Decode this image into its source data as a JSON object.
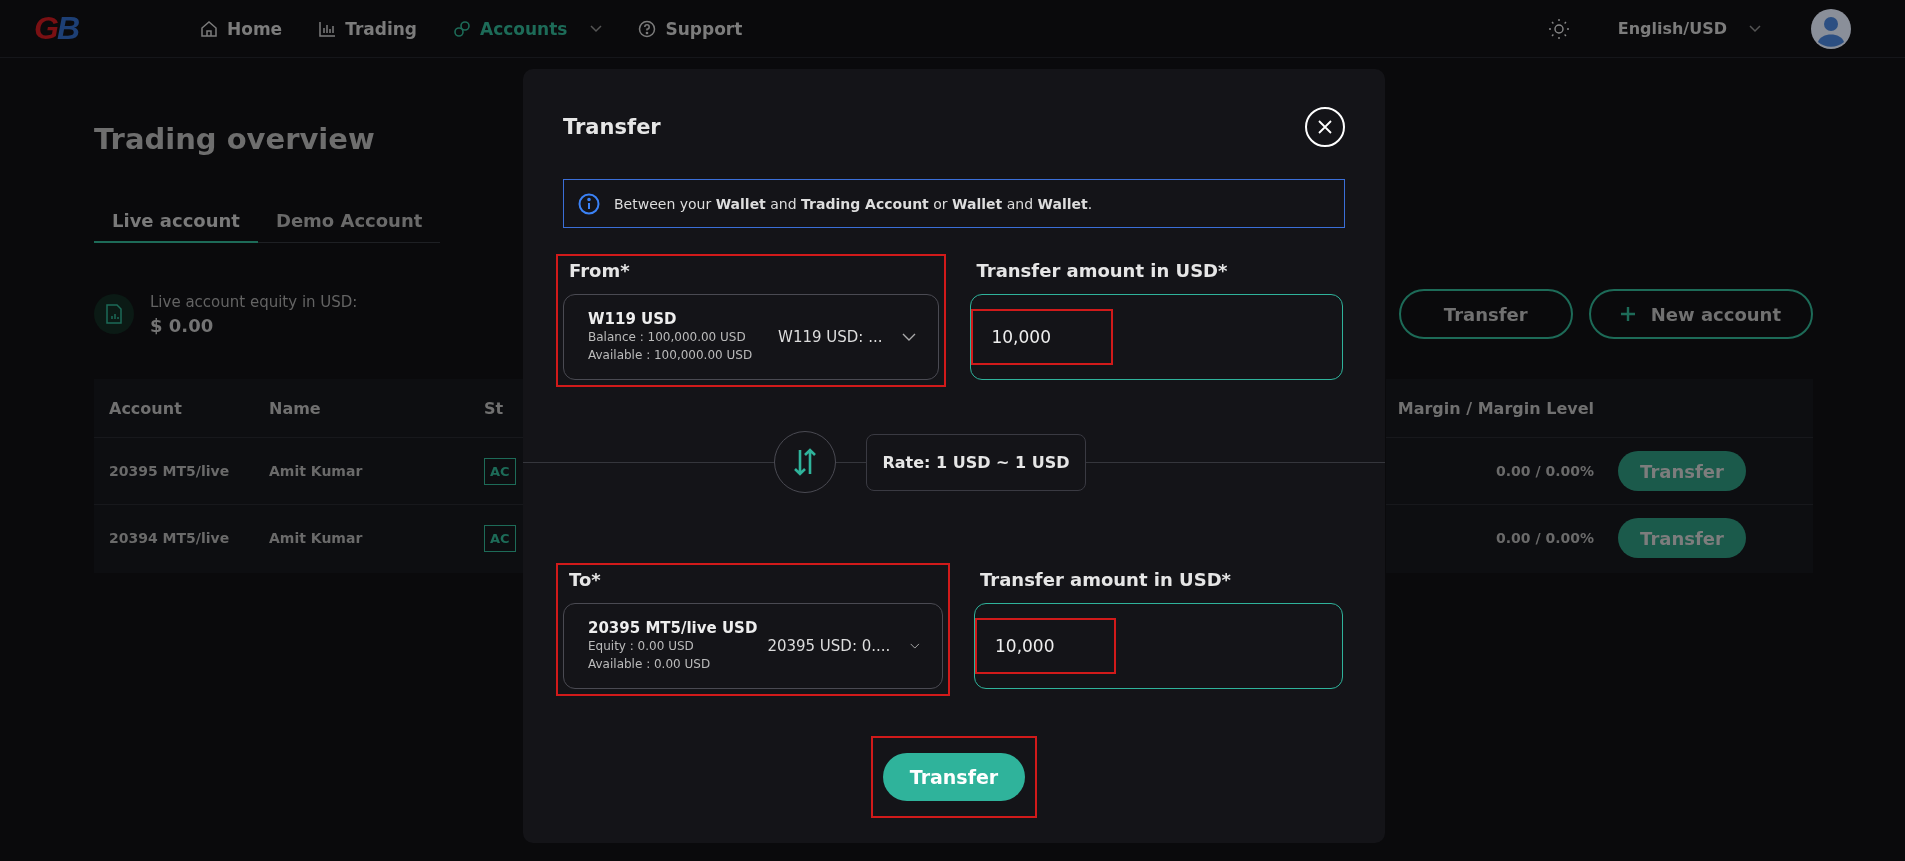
{
  "logo": {
    "first": "G",
    "second": "B"
  },
  "nav": [
    {
      "label": "Home",
      "selected": false,
      "dropdown": false
    },
    {
      "label": "Trading",
      "selected": false,
      "dropdown": false
    },
    {
      "label": "Accounts",
      "selected": true,
      "dropdown": true
    },
    {
      "label": "Support",
      "selected": false,
      "dropdown": false
    }
  ],
  "language": "English/USD",
  "page": {
    "title": "Trading overview",
    "tabs": [
      {
        "label": "Live account",
        "selected": true
      },
      {
        "label": "Demo Account",
        "selected": false
      }
    ],
    "equity_label": "Live account equity in USD:",
    "equity_value": "$ 0.00",
    "buttons": [
      {
        "label": "Transfer",
        "kind": "plain"
      },
      {
        "label": "New account",
        "kind": "add"
      }
    ],
    "table": {
      "columns": [
        "Account",
        "Name",
        "St"
      ],
      "right_column": "Margin / Margin Level",
      "rows": [
        {
          "account": "20395 MT5/live",
          "name": "Amit Kumar",
          "status": "AC",
          "margin": "0.00 / 0.00%",
          "action": "Transfer"
        },
        {
          "account": "20394 MT5/live",
          "name": "Amit Kumar",
          "status": "AC",
          "margin": "0.00 / 0.00%",
          "action": "Transfer"
        }
      ]
    }
  },
  "modal": {
    "title": "Transfer",
    "info": "Between your **Wallet** and **Trading Account** or **Wallet** and **Wallet**.",
    "from": {
      "label": "From*",
      "account": "W119 USD",
      "line_1": "Balance : 100,000.00 USD",
      "line_2": "Available : 100,000.00 USD",
      "selected_text": "W119 USD: ...",
      "annotated": true
    },
    "from_amount": {
      "label": "Transfer amount in USD*",
      "value": "10,000",
      "annotated": true
    },
    "rate": "Rate: 1 USD ~ 1 USD",
    "to": {
      "label": "To*",
      "account": "20395 MT5/live USD",
      "line_1": "Equity : 0.00 USD",
      "line_2": "Available : 0.00 USD",
      "selected_text": "20395 USD: 0....",
      "annotated": true
    },
    "to_amount": {
      "label": "Transfer amount in USD*",
      "value": "10,000",
      "annotated": true
    },
    "submit": {
      "label": "Transfer",
      "annotated": true
    }
  }
}
